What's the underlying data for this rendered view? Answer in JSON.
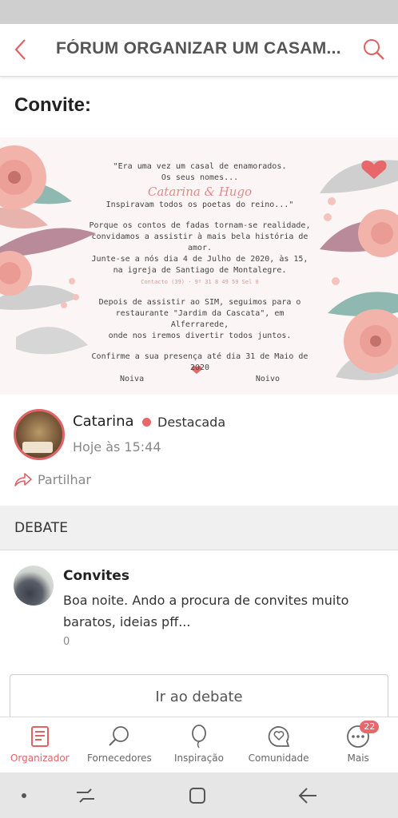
{
  "header": {
    "title": "FÓRUM ORGANIZAR UM CASAM..."
  },
  "section": {
    "title": "Convite:"
  },
  "invite": {
    "line1": "\"Era uma vez um casal de enamorados.",
    "line2": "Os seus nomes...",
    "names": "Catarina & Hugo",
    "line3": "Inspiravam todos os poetas do reino...\"",
    "para1_1": "Porque os contos de fadas tornam-se realidade,",
    "para1_2": "convidamos a assistir à mais bela história de",
    "para1_3": "amor.",
    "para1_4": "Junte-se a nós dia 4 de Julho de 2020, às 15,",
    "para1_5": "na igreja de Santiago de Montalegre.",
    "para1_6": "Contacto (39) · 9º 31 8 49 59 Sel 0",
    "para2_1": "Depois de assistir ao SIM, seguimos para o",
    "para2_2": "restaurante \"Jardim da Cascata\", em Alferrarede,",
    "para2_3": "onde nos iremos divertir todos juntos.",
    "confirm": "Confirme a sua presença até dia 31 de Maio de 2020",
    "bride": "Noiva",
    "groom": "Noivo"
  },
  "post": {
    "author": "Catarina",
    "badge": "Destacada",
    "time": "Hoje às 15:44",
    "share": "Partilhar"
  },
  "debate": {
    "header": "DEBATE",
    "title": "Convites",
    "body": "Boa noite. Ando a procura de convites muito baratos, ideias pff...",
    "count": "0",
    "button": "Ir ao debate"
  },
  "tabs": [
    {
      "label": "Organizador",
      "icon": "notebook-icon",
      "active": true
    },
    {
      "label": "Fornecedores",
      "icon": "search-icon"
    },
    {
      "label": "Inspiração",
      "icon": "balloon-icon"
    },
    {
      "label": "Comunidade",
      "icon": "heart-chat-icon"
    },
    {
      "label": "Mais",
      "icon": "more-icon",
      "badge": "22"
    }
  ],
  "colors": {
    "accent": "#e16366",
    "badge": "#e8676b"
  }
}
